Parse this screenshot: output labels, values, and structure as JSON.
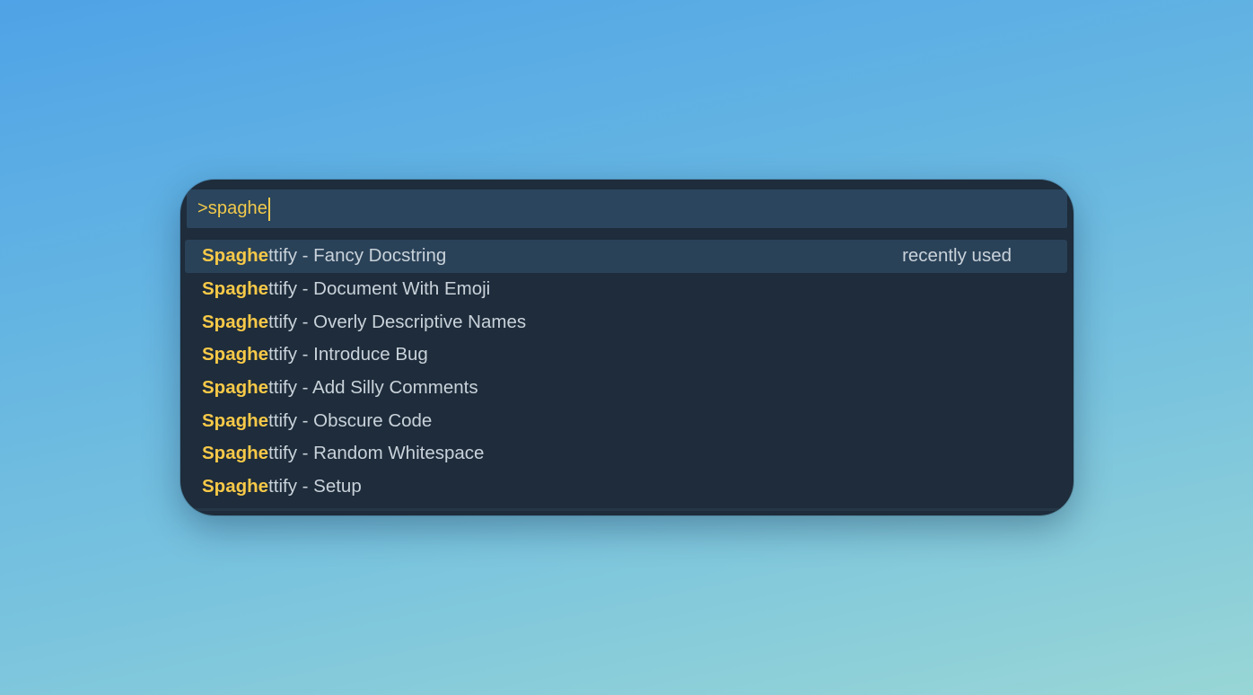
{
  "command_palette": {
    "input": {
      "value": ">spaghe"
    },
    "results": [
      {
        "match": "Spaghe",
        "rest": "ttify - Fancy Docstring",
        "selected": true,
        "tag": "recently used",
        "icon": "gear-icon"
      },
      {
        "match": "Spaghe",
        "rest": "ttify - Document With Emoji"
      },
      {
        "match": "Spaghe",
        "rest": "ttify - Overly Descriptive Names"
      },
      {
        "match": "Spaghe",
        "rest": "ttify - Introduce Bug"
      },
      {
        "match": "Spaghe",
        "rest": "ttify - Add Silly Comments"
      },
      {
        "match": "Spaghe",
        "rest": "ttify - Obscure Code"
      },
      {
        "match": "Spaghe",
        "rest": "ttify - Random Whitespace"
      },
      {
        "match": "Spaghe",
        "rest": "ttify - Setup"
      }
    ]
  },
  "colors": {
    "match_highlight": "#f7c948",
    "input_text": "#f2c94c",
    "palette_background": "#1e2c3b",
    "input_background": "#2a455d",
    "selected_row": "#2a4258"
  }
}
